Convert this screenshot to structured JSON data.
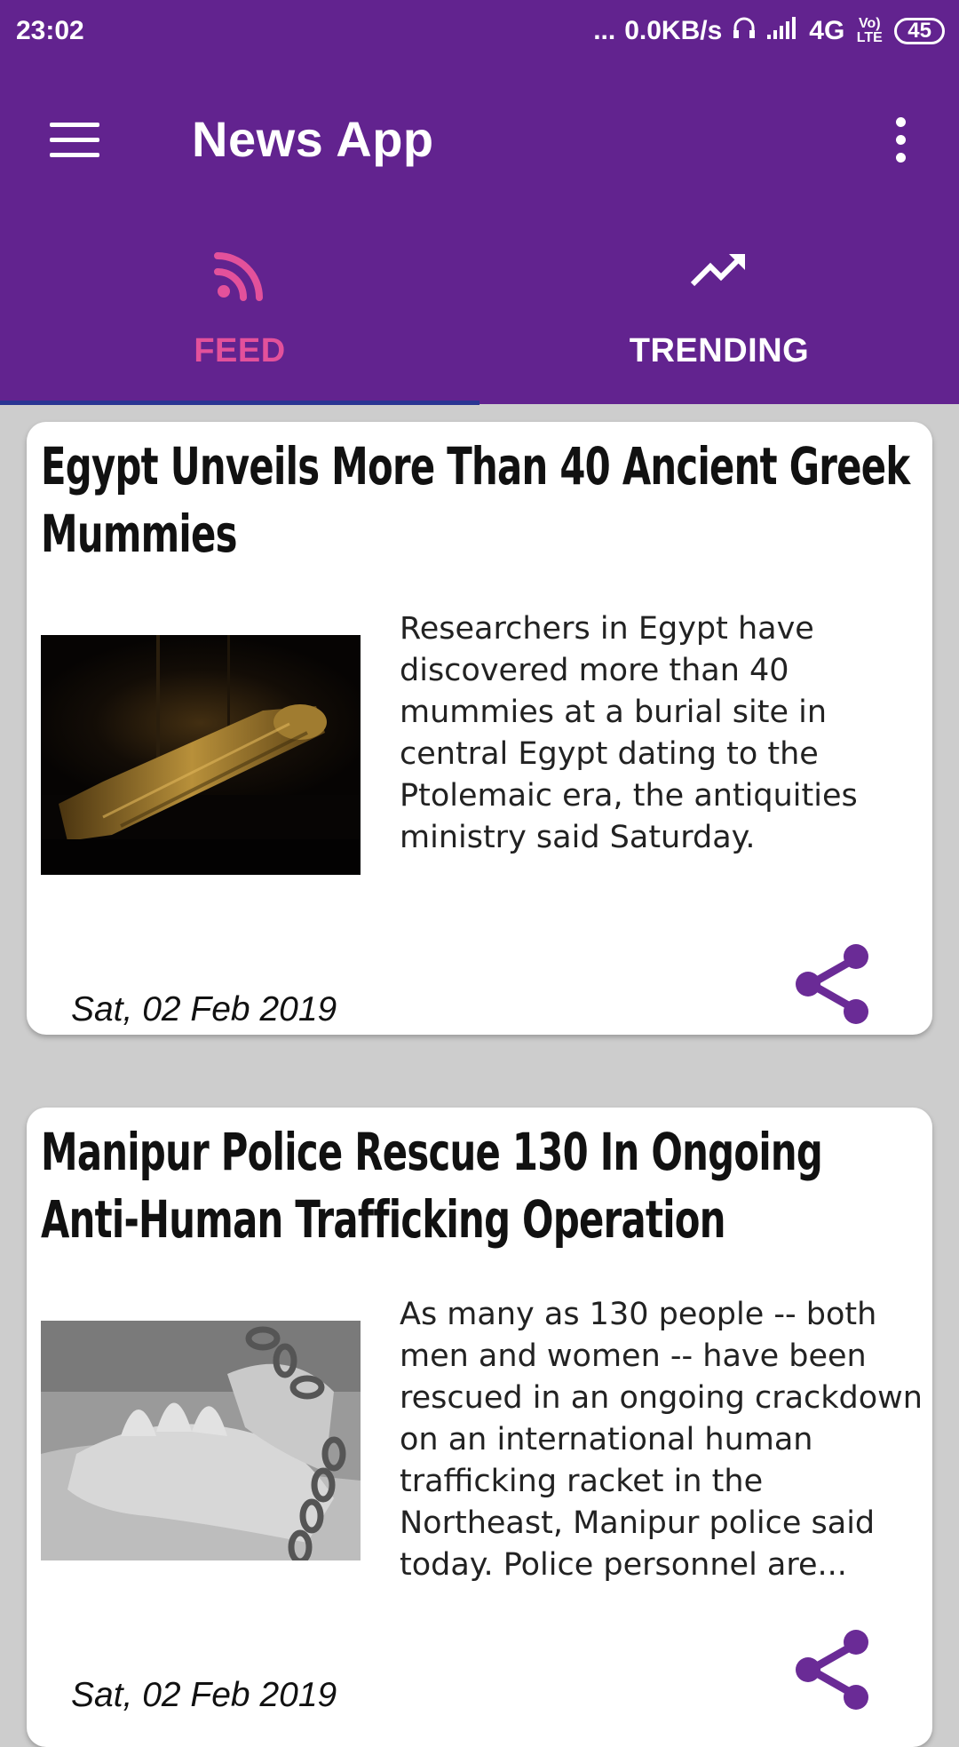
{
  "status_bar": {
    "time": "23:02",
    "dots": "...",
    "speed": "0.0KB/s",
    "network": "4G",
    "volte": "Vo) LTE",
    "battery": "45"
  },
  "toolbar": {
    "title": "News App",
    "menu_icon": "hamburger-menu-icon",
    "more_icon": "more-vertical-icon"
  },
  "tabs": [
    {
      "label": "FEED",
      "icon": "rss-feed-icon",
      "active": true
    },
    {
      "label": "TRENDING",
      "icon": "trending-up-icon",
      "active": false
    }
  ],
  "colors": {
    "primary": "#62238f",
    "accent": "#e3519b",
    "indicator": "#2a3593",
    "share": "#6a2b96"
  },
  "articles": [
    {
      "title": "Egypt Unveils More Than 40 Ancient Greek Mummies",
      "description": "Researchers in Egypt have discovered more than 40 mummies at a burial site in central Egypt dating to the Ptolemaic era, the antiquities ministry said Saturday.",
      "date": "Sat, 02 Feb 2019",
      "image": "mummy-photo"
    },
    {
      "title": "Manipur Police Rescue 130 In Ongoing Anti-Human Trafficking Operation",
      "description": "As many as 130 people -- both men and women -- have been rescued in an ongoing crackdown on an international human trafficking racket in the Northeast, Manipur police said today. Police personnel are...",
      "date": "Sat, 02 Feb 2019",
      "image": "chained-hands-photo"
    }
  ]
}
